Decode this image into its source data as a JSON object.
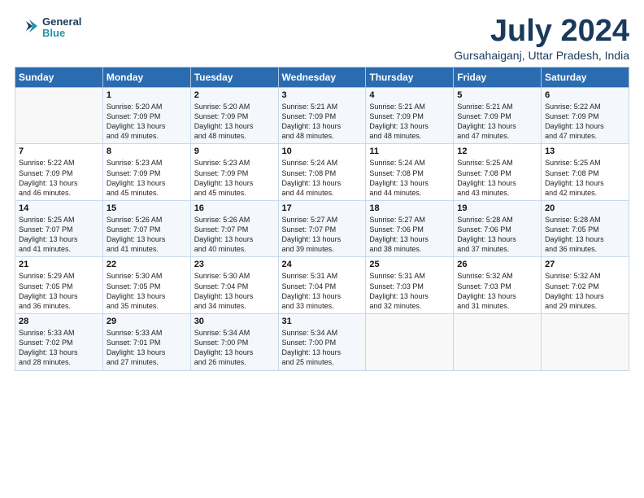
{
  "logo": {
    "line1": "General",
    "line2": "Blue"
  },
  "title": "July 2024",
  "location": "Gursahaiganj, Uttar Pradesh, India",
  "days_of_week": [
    "Sunday",
    "Monday",
    "Tuesday",
    "Wednesday",
    "Thursday",
    "Friday",
    "Saturday"
  ],
  "weeks": [
    [
      {
        "day": "",
        "content": ""
      },
      {
        "day": "1",
        "content": "Sunrise: 5:20 AM\nSunset: 7:09 PM\nDaylight: 13 hours\nand 49 minutes."
      },
      {
        "day": "2",
        "content": "Sunrise: 5:20 AM\nSunset: 7:09 PM\nDaylight: 13 hours\nand 48 minutes."
      },
      {
        "day": "3",
        "content": "Sunrise: 5:21 AM\nSunset: 7:09 PM\nDaylight: 13 hours\nand 48 minutes."
      },
      {
        "day": "4",
        "content": "Sunrise: 5:21 AM\nSunset: 7:09 PM\nDaylight: 13 hours\nand 48 minutes."
      },
      {
        "day": "5",
        "content": "Sunrise: 5:21 AM\nSunset: 7:09 PM\nDaylight: 13 hours\nand 47 minutes."
      },
      {
        "day": "6",
        "content": "Sunrise: 5:22 AM\nSunset: 7:09 PM\nDaylight: 13 hours\nand 47 minutes."
      }
    ],
    [
      {
        "day": "7",
        "content": "Sunrise: 5:22 AM\nSunset: 7:09 PM\nDaylight: 13 hours\nand 46 minutes."
      },
      {
        "day": "8",
        "content": "Sunrise: 5:23 AM\nSunset: 7:09 PM\nDaylight: 13 hours\nand 45 minutes."
      },
      {
        "day": "9",
        "content": "Sunrise: 5:23 AM\nSunset: 7:09 PM\nDaylight: 13 hours\nand 45 minutes."
      },
      {
        "day": "10",
        "content": "Sunrise: 5:24 AM\nSunset: 7:08 PM\nDaylight: 13 hours\nand 44 minutes."
      },
      {
        "day": "11",
        "content": "Sunrise: 5:24 AM\nSunset: 7:08 PM\nDaylight: 13 hours\nand 44 minutes."
      },
      {
        "day": "12",
        "content": "Sunrise: 5:25 AM\nSunset: 7:08 PM\nDaylight: 13 hours\nand 43 minutes."
      },
      {
        "day": "13",
        "content": "Sunrise: 5:25 AM\nSunset: 7:08 PM\nDaylight: 13 hours\nand 42 minutes."
      }
    ],
    [
      {
        "day": "14",
        "content": "Sunrise: 5:25 AM\nSunset: 7:07 PM\nDaylight: 13 hours\nand 41 minutes."
      },
      {
        "day": "15",
        "content": "Sunrise: 5:26 AM\nSunset: 7:07 PM\nDaylight: 13 hours\nand 41 minutes."
      },
      {
        "day": "16",
        "content": "Sunrise: 5:26 AM\nSunset: 7:07 PM\nDaylight: 13 hours\nand 40 minutes."
      },
      {
        "day": "17",
        "content": "Sunrise: 5:27 AM\nSunset: 7:07 PM\nDaylight: 13 hours\nand 39 minutes."
      },
      {
        "day": "18",
        "content": "Sunrise: 5:27 AM\nSunset: 7:06 PM\nDaylight: 13 hours\nand 38 minutes."
      },
      {
        "day": "19",
        "content": "Sunrise: 5:28 AM\nSunset: 7:06 PM\nDaylight: 13 hours\nand 37 minutes."
      },
      {
        "day": "20",
        "content": "Sunrise: 5:28 AM\nSunset: 7:05 PM\nDaylight: 13 hours\nand 36 minutes."
      }
    ],
    [
      {
        "day": "21",
        "content": "Sunrise: 5:29 AM\nSunset: 7:05 PM\nDaylight: 13 hours\nand 36 minutes."
      },
      {
        "day": "22",
        "content": "Sunrise: 5:30 AM\nSunset: 7:05 PM\nDaylight: 13 hours\nand 35 minutes."
      },
      {
        "day": "23",
        "content": "Sunrise: 5:30 AM\nSunset: 7:04 PM\nDaylight: 13 hours\nand 34 minutes."
      },
      {
        "day": "24",
        "content": "Sunrise: 5:31 AM\nSunset: 7:04 PM\nDaylight: 13 hours\nand 33 minutes."
      },
      {
        "day": "25",
        "content": "Sunrise: 5:31 AM\nSunset: 7:03 PM\nDaylight: 13 hours\nand 32 minutes."
      },
      {
        "day": "26",
        "content": "Sunrise: 5:32 AM\nSunset: 7:03 PM\nDaylight: 13 hours\nand 31 minutes."
      },
      {
        "day": "27",
        "content": "Sunrise: 5:32 AM\nSunset: 7:02 PM\nDaylight: 13 hours\nand 29 minutes."
      }
    ],
    [
      {
        "day": "28",
        "content": "Sunrise: 5:33 AM\nSunset: 7:02 PM\nDaylight: 13 hours\nand 28 minutes."
      },
      {
        "day": "29",
        "content": "Sunrise: 5:33 AM\nSunset: 7:01 PM\nDaylight: 13 hours\nand 27 minutes."
      },
      {
        "day": "30",
        "content": "Sunrise: 5:34 AM\nSunset: 7:00 PM\nDaylight: 13 hours\nand 26 minutes."
      },
      {
        "day": "31",
        "content": "Sunrise: 5:34 AM\nSunset: 7:00 PM\nDaylight: 13 hours\nand 25 minutes."
      },
      {
        "day": "",
        "content": ""
      },
      {
        "day": "",
        "content": ""
      },
      {
        "day": "",
        "content": ""
      }
    ]
  ]
}
